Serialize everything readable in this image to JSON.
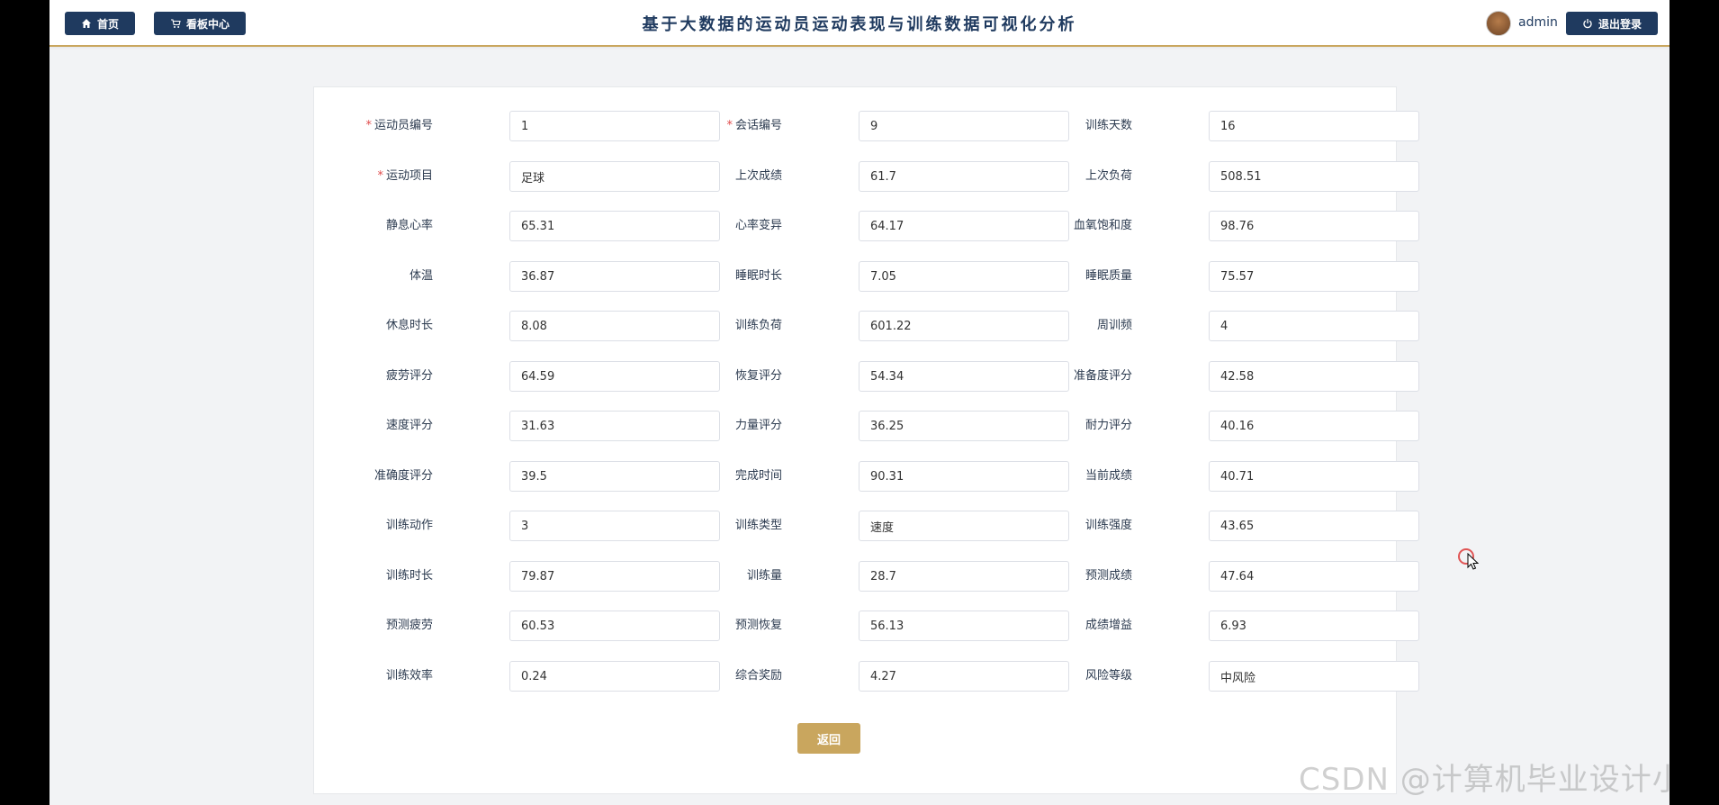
{
  "header": {
    "home_label": "首页",
    "dashboard_label": "看板中心",
    "title": "基于大数据的运动员运动表现与训练数据可视化分析",
    "username": "admin",
    "logout_label": "退出登录"
  },
  "form": {
    "fields": [
      {
        "label": "运动员编号",
        "value": "1",
        "required": "*"
      },
      {
        "label": "会话编号",
        "value": "9",
        "required": "*"
      },
      {
        "label": "训练天数",
        "value": "16"
      },
      {
        "label": "运动项目",
        "value": "足球",
        "required": "*"
      },
      {
        "label": "上次成绩",
        "value": "61.7"
      },
      {
        "label": "上次负荷",
        "value": "508.51"
      },
      {
        "label": "静息心率",
        "value": "65.31"
      },
      {
        "label": "心率变异",
        "value": "64.17"
      },
      {
        "label": "血氧饱和度",
        "value": "98.76"
      },
      {
        "label": "体温",
        "value": "36.87"
      },
      {
        "label": "睡眠时长",
        "value": "7.05"
      },
      {
        "label": "睡眠质量",
        "value": "75.57"
      },
      {
        "label": "休息时长",
        "value": "8.08"
      },
      {
        "label": "训练负荷",
        "value": "601.22"
      },
      {
        "label": "周训频",
        "value": "4"
      },
      {
        "label": "疲劳评分",
        "value": "64.59"
      },
      {
        "label": "恢复评分",
        "value": "54.34"
      },
      {
        "label": "准备度评分",
        "value": "42.58"
      },
      {
        "label": "速度评分",
        "value": "31.63"
      },
      {
        "label": "力量评分",
        "value": "36.25"
      },
      {
        "label": "耐力评分",
        "value": "40.16"
      },
      {
        "label": "准确度评分",
        "value": "39.5"
      },
      {
        "label": "完成时间",
        "value": "90.31"
      },
      {
        "label": "当前成绩",
        "value": "40.71"
      },
      {
        "label": "训练动作",
        "value": "3"
      },
      {
        "label": "训练类型",
        "value": "速度"
      },
      {
        "label": "训练强度",
        "value": "43.65"
      },
      {
        "label": "训练时长",
        "value": "79.87"
      },
      {
        "label": "训练量",
        "value": "28.7"
      },
      {
        "label": "预测成绩",
        "value": "47.64"
      },
      {
        "label": "预测疲劳",
        "value": "60.53"
      },
      {
        "label": "预测恢复",
        "value": "56.13"
      },
      {
        "label": "成绩增益",
        "value": "6.93"
      },
      {
        "label": "训练效率",
        "value": "0.24"
      },
      {
        "label": "综合奖励",
        "value": "4.27"
      },
      {
        "label": "风险等级",
        "value": "中风险"
      }
    ],
    "back_label": "返回"
  },
  "watermark": "CSDN @计算机毕业设计小明哥",
  "colors": {
    "primary": "#1f3a5f",
    "accent": "#c9a65e",
    "required": "#e04c4c"
  },
  "icons": {
    "home": "home-icon",
    "dashboard": "cart-icon",
    "logout": "power-icon"
  }
}
